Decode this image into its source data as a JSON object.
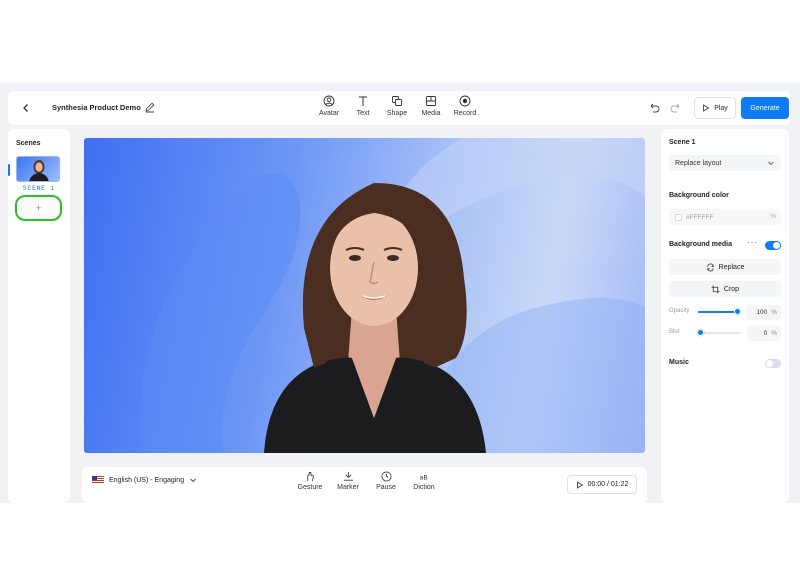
{
  "header": {
    "project_title": "Synthesia Product Demo",
    "tools": [
      {
        "label": "Avatar",
        "icon": "avatar-icon"
      },
      {
        "label": "Text",
        "icon": "text-icon"
      },
      {
        "label": "Shape",
        "icon": "shape-icon"
      },
      {
        "label": "Media",
        "icon": "media-icon"
      },
      {
        "label": "Record",
        "icon": "record-icon"
      }
    ],
    "play_label": "Play",
    "generate_label": "Generate"
  },
  "scenes": {
    "title": "Scenes",
    "items": [
      {
        "label": "SCENE 1"
      }
    ],
    "add_label": "+"
  },
  "script_bar": {
    "voice_label": "English (US) - Engaging",
    "tools": [
      {
        "label": "Gesture",
        "icon": "gesture-icon"
      },
      {
        "label": "Marker",
        "icon": "marker-icon"
      },
      {
        "label": "Pause",
        "icon": "pause-clock-icon"
      },
      {
        "label": "Diction",
        "icon": "diction-icon"
      }
    ],
    "timecode": "00:00 / 01:22"
  },
  "panel": {
    "scene_title": "Scene 1",
    "layout_select": "Replace layout",
    "bg_color_title": "Background color",
    "bg_color_value": "#FFFFFF",
    "bg_color_unit": "%",
    "bg_media_title": "Background media",
    "bg_media_enabled": true,
    "replace_label": "Replace",
    "crop_label": "Crop",
    "opacity_label": "Opacity",
    "opacity_value": "100",
    "opacity_unit": "%",
    "blur_label": "Blur",
    "blur_value": "0",
    "blur_unit": "%",
    "music_title": "Music",
    "music_enabled": false
  },
  "colors": {
    "accent": "#0e7cf4",
    "highlight": "#27c227"
  }
}
